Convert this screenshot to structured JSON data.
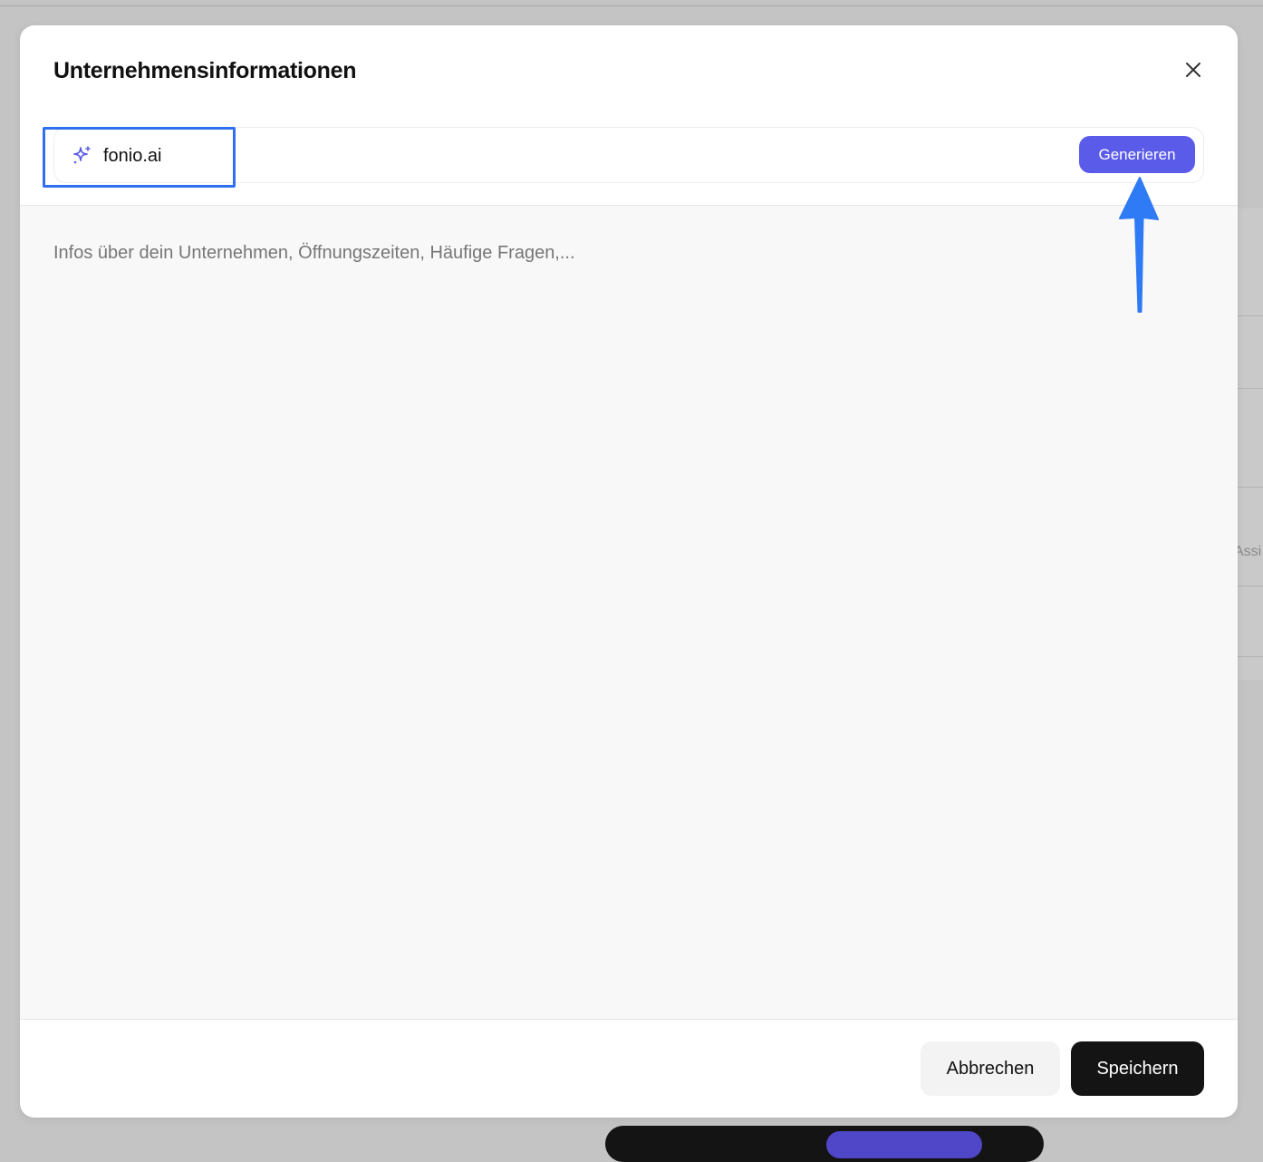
{
  "background": {
    "partial_text": "Assi"
  },
  "modal": {
    "title": "Unternehmensinformationen",
    "close_icon": "close-icon",
    "url_bar": {
      "icon": "sparkles-icon",
      "value": "fonio.ai",
      "generate_label": "Generieren"
    },
    "textarea": {
      "placeholder": "Infos über dein Unternehmen, Öffnungszeiten, Häufige Fragen,...",
      "value": ""
    },
    "footer": {
      "cancel_label": "Abbrechen",
      "save_label": "Speichern"
    }
  },
  "annotations": {
    "highlight_color": "#2f6ff0",
    "arrow_color": "#2f7af5"
  },
  "colors": {
    "accent": "#5b5bea",
    "primary_button": "#141414",
    "overlay": "#c4c4c4"
  }
}
